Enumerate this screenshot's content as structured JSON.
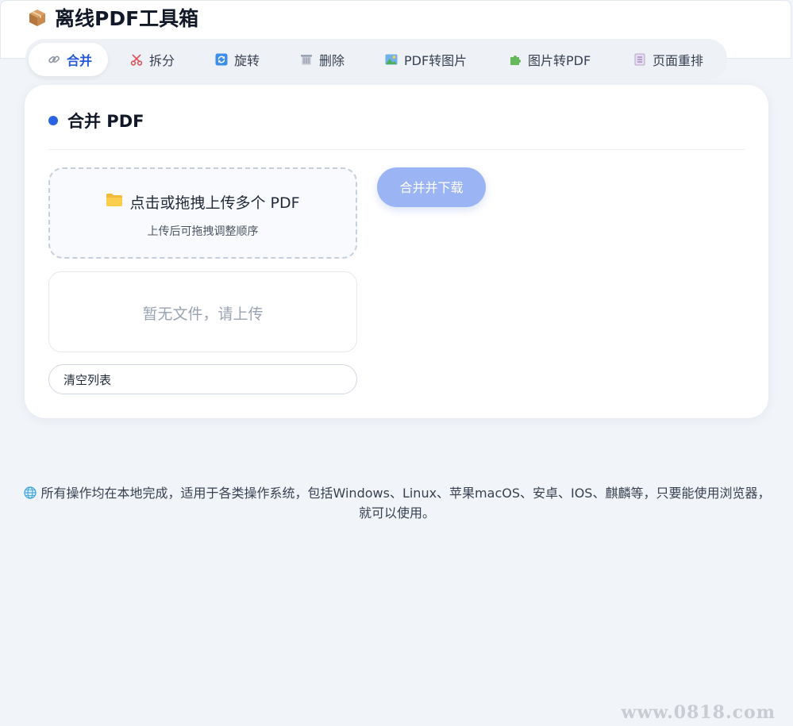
{
  "app": {
    "title": "离线PDF工具箱",
    "icon": "package-icon"
  },
  "tabs": [
    {
      "label": "合并",
      "icon": "link-icon",
      "active": true
    },
    {
      "label": "拆分",
      "icon": "scissors-icon",
      "active": false
    },
    {
      "label": "旋转",
      "icon": "rotate-icon",
      "active": false
    },
    {
      "label": "删除",
      "icon": "trash-icon",
      "active": false
    },
    {
      "label": "PDF转图片",
      "icon": "picture-icon",
      "active": false
    },
    {
      "label": "图片转PDF",
      "icon": "puzzle-icon",
      "active": false
    },
    {
      "label": "页面重排",
      "icon": "bookmark-tabs-icon",
      "active": false
    }
  ],
  "panel": {
    "title": "合并 PDF",
    "dropzone_main": "点击或拖拽上传多个 PDF",
    "dropzone_sub": "上传后可拖拽调整顺序",
    "empty_text": "暂无文件，请上传",
    "clear_label": "清空列表",
    "merge_label": "合并并下载"
  },
  "footer": {
    "note": "所有操作均在本地完成，适用于各类操作系统，包括Windows、Linux、苹果macOS、安卓、IOS、麒麟等，只要能使用浏览器，就可以使用。"
  },
  "watermark": "www.0818.com",
  "colors": {
    "accent": "#2558d6",
    "dot": "#2a63e0",
    "merge_button": "#9bb4f4",
    "background": "#f1f4f9"
  }
}
